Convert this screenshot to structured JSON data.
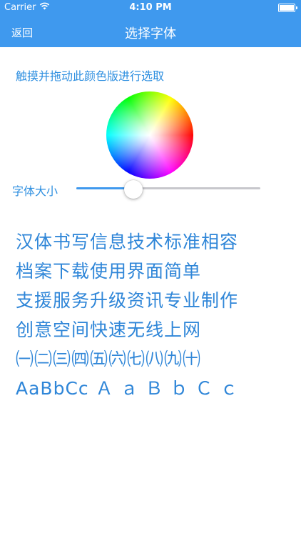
{
  "status_bar": {
    "carrier": "Carrier",
    "time": "4:10 PM",
    "wifi_icon": "wifi-icon",
    "battery_icon": "battery-icon"
  },
  "nav": {
    "back_label": "返回",
    "title": "选择字体"
  },
  "instruction": "触摸并拖动此颜色版进行选取",
  "color_picker": {
    "icon": "color-wheel"
  },
  "font_size": {
    "label": "字体大小",
    "value": 0.31
  },
  "sample_lines": [
    "汉体书写信息技术标准相容",
    "档案下载使用界面简单",
    "支援服务升级资讯专业制作",
    "创意空间快速无线上网",
    "㈠㈡㈢㈣㈤㈥㈦㈧㈨㈩",
    "AaBbCc Ａ ａ Ｂ ｂ Ｃ ｃ"
  ],
  "colors": {
    "nav_background": "#3f99ee",
    "accent_text": "#2e8fe0",
    "sample_text": "#2f86d8",
    "track": "#c7c7cc"
  }
}
